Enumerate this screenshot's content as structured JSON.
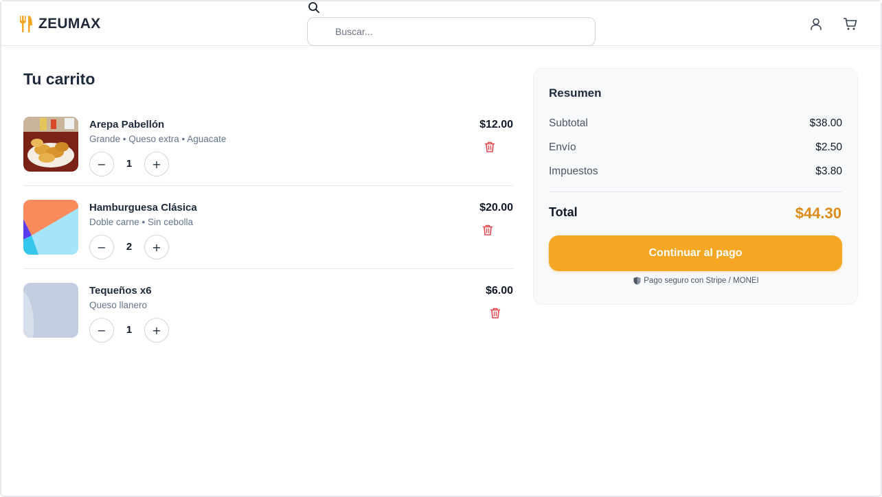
{
  "header": {
    "brand": "ZEUMAX",
    "brand_icon": "utensils-icon",
    "search_placeholder": "Buscar...",
    "icons": [
      "search-icon",
      "user-icon",
      "cart-icon"
    ]
  },
  "cart": {
    "title": "Tu carrito",
    "items": [
      {
        "name": "Arepa Pabellón",
        "options": "Grande • Queso extra • Aguacate",
        "quantity": "1",
        "price": "$12.00",
        "image": "arepa-photo"
      },
      {
        "name": "Hamburguesa Clásica",
        "options": "Doble carne • Sin cebolla",
        "quantity": "2",
        "price": "$20.00",
        "image": "abstract-placeholder"
      },
      {
        "name": "Tequeños x6",
        "options": "Queso llanero",
        "quantity": "1",
        "price": "$6.00",
        "image": "gray-placeholder"
      }
    ],
    "minus_symbol": "−",
    "plus_symbol": "+"
  },
  "summary": {
    "title": "Resumen",
    "rows": [
      {
        "label": "Subtotal",
        "value": "$38.00"
      },
      {
        "label": "Envío",
        "value": "$2.50"
      },
      {
        "label": "Impuestos",
        "value": "$3.80"
      }
    ],
    "total_label": "Total",
    "total_value": "$44.30",
    "pay_button": "Continuar al pago",
    "secure_note": "Pago seguro con Stripe / MONEI"
  },
  "colors": {
    "accent": "#f5a623",
    "total": "#dc8a18",
    "trash": "#e5484d",
    "text": "#1e293b"
  }
}
